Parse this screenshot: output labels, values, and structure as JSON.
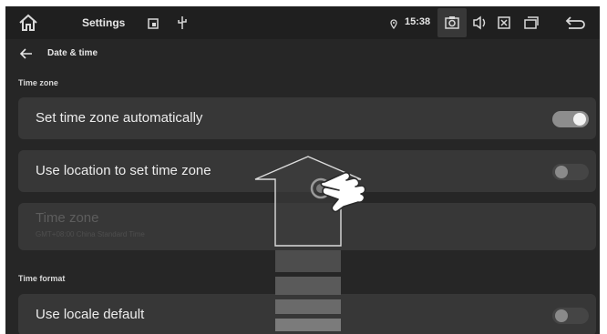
{
  "status_bar": {
    "app_name": "Settings",
    "time": "15:38",
    "icons": [
      "home-icon",
      "screenshot-icon",
      "usb-icon",
      "location-icon",
      "camera-icon",
      "volume-icon",
      "close-box-icon",
      "recent-apps-icon",
      "back-icon"
    ]
  },
  "header": {
    "title": "Date & time"
  },
  "sections": {
    "time_zone": "Time zone",
    "time_format": "Time format"
  },
  "settings": {
    "auto_timezone": {
      "label": "Set time zone automatically",
      "enabled": true
    },
    "location_timezone": {
      "label": "Use location to set time zone",
      "enabled": false
    },
    "timezone": {
      "label": "Time zone",
      "value": "GMT+08:00 China Standard Time"
    },
    "locale_default": {
      "label": "Use locale default",
      "enabled": false
    }
  },
  "gesture": {
    "direction": "swipe-up",
    "icon": "pointing-hand-icon"
  },
  "colors": {
    "background": "#262626",
    "card": "#373737",
    "status_bar": "#1f1f1f"
  }
}
